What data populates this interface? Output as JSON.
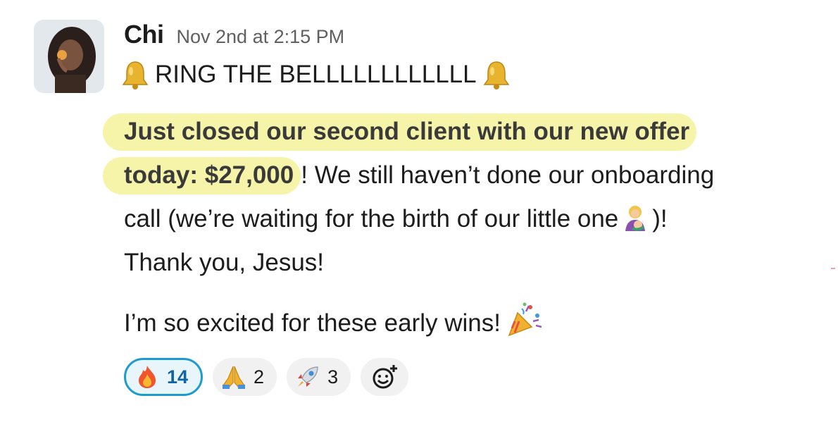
{
  "message": {
    "author": "Chi",
    "timestamp": "Nov 2nd at 2:15 PM",
    "headline": "RING THE BELLLLLLLLLLLL",
    "line1_highlight": "Just closed our second client with our new offer",
    "line2_highlight": "today: $27,000",
    "line2_rest": "! We still haven’t done our onboarding",
    "line3_text": "call (we’re waiting for the birth of our little one",
    "line3_end": ")!",
    "line4": "Thank you, Jesus!",
    "line5": "I’m so excited for these early wins!"
  },
  "icons": {
    "headline_left": "bell-icon",
    "headline_right": "bell-icon",
    "inline": "breastfeeding-emoji",
    "closing": "party-popper-emoji"
  },
  "reactions": [
    {
      "emoji": "fire-emoji",
      "count": "14",
      "active": true
    },
    {
      "emoji": "folded-hands-emoji",
      "count": "2",
      "active": false
    },
    {
      "emoji": "rocket-emoji",
      "count": "3",
      "active": false
    },
    {
      "emoji": "add-reaction-icon",
      "count": "",
      "active": false
    }
  ],
  "colors": {
    "highlight": "#f6f4a8",
    "active_reaction_border": "#1d9bd1",
    "active_reaction_text": "#1264a3"
  }
}
